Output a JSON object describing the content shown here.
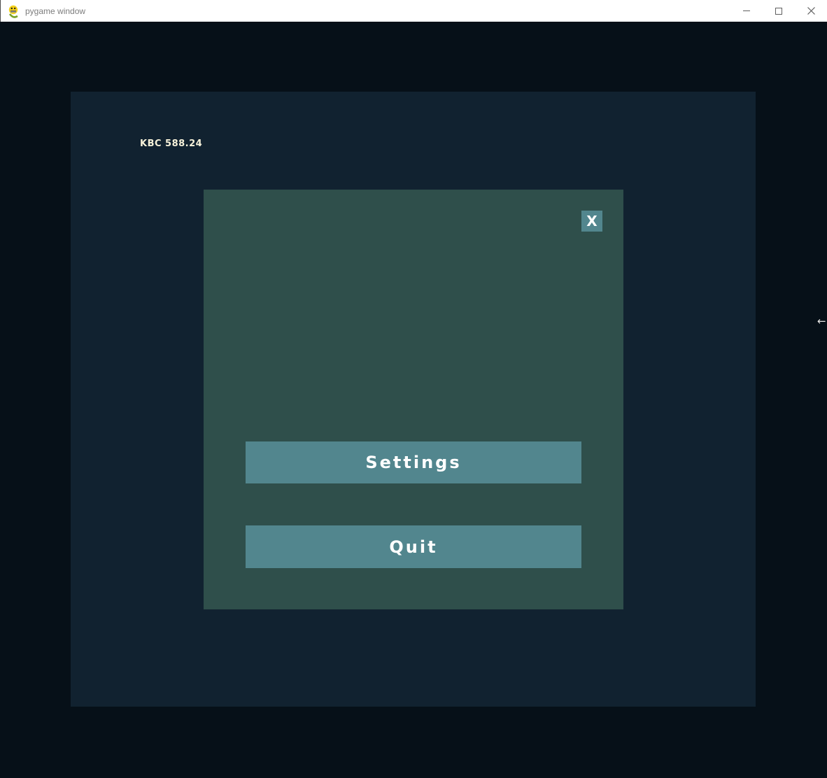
{
  "window": {
    "title": "pygame window",
    "icons": {
      "app": "pygame-snake-icon",
      "minimize": "minimize-dash",
      "maximize": "maximize-square",
      "close": "close-x"
    }
  },
  "game": {
    "hud": {
      "score": "KBC 588.24"
    },
    "pause_menu": {
      "close_label": "X",
      "settings_label": "Settings",
      "quit_label": "Quit"
    },
    "cursor_glyph": "←"
  },
  "colors": {
    "titlebar_bg": "#ffffff",
    "titlebar_text": "#7d7d7d",
    "stage_bg": "#061018",
    "panel_bg": "#112230",
    "dialog_bg": "#2f4f4b",
    "button_bg": "#52868e",
    "button_text": "#ffffff",
    "hud_text": "#f7f2da"
  }
}
